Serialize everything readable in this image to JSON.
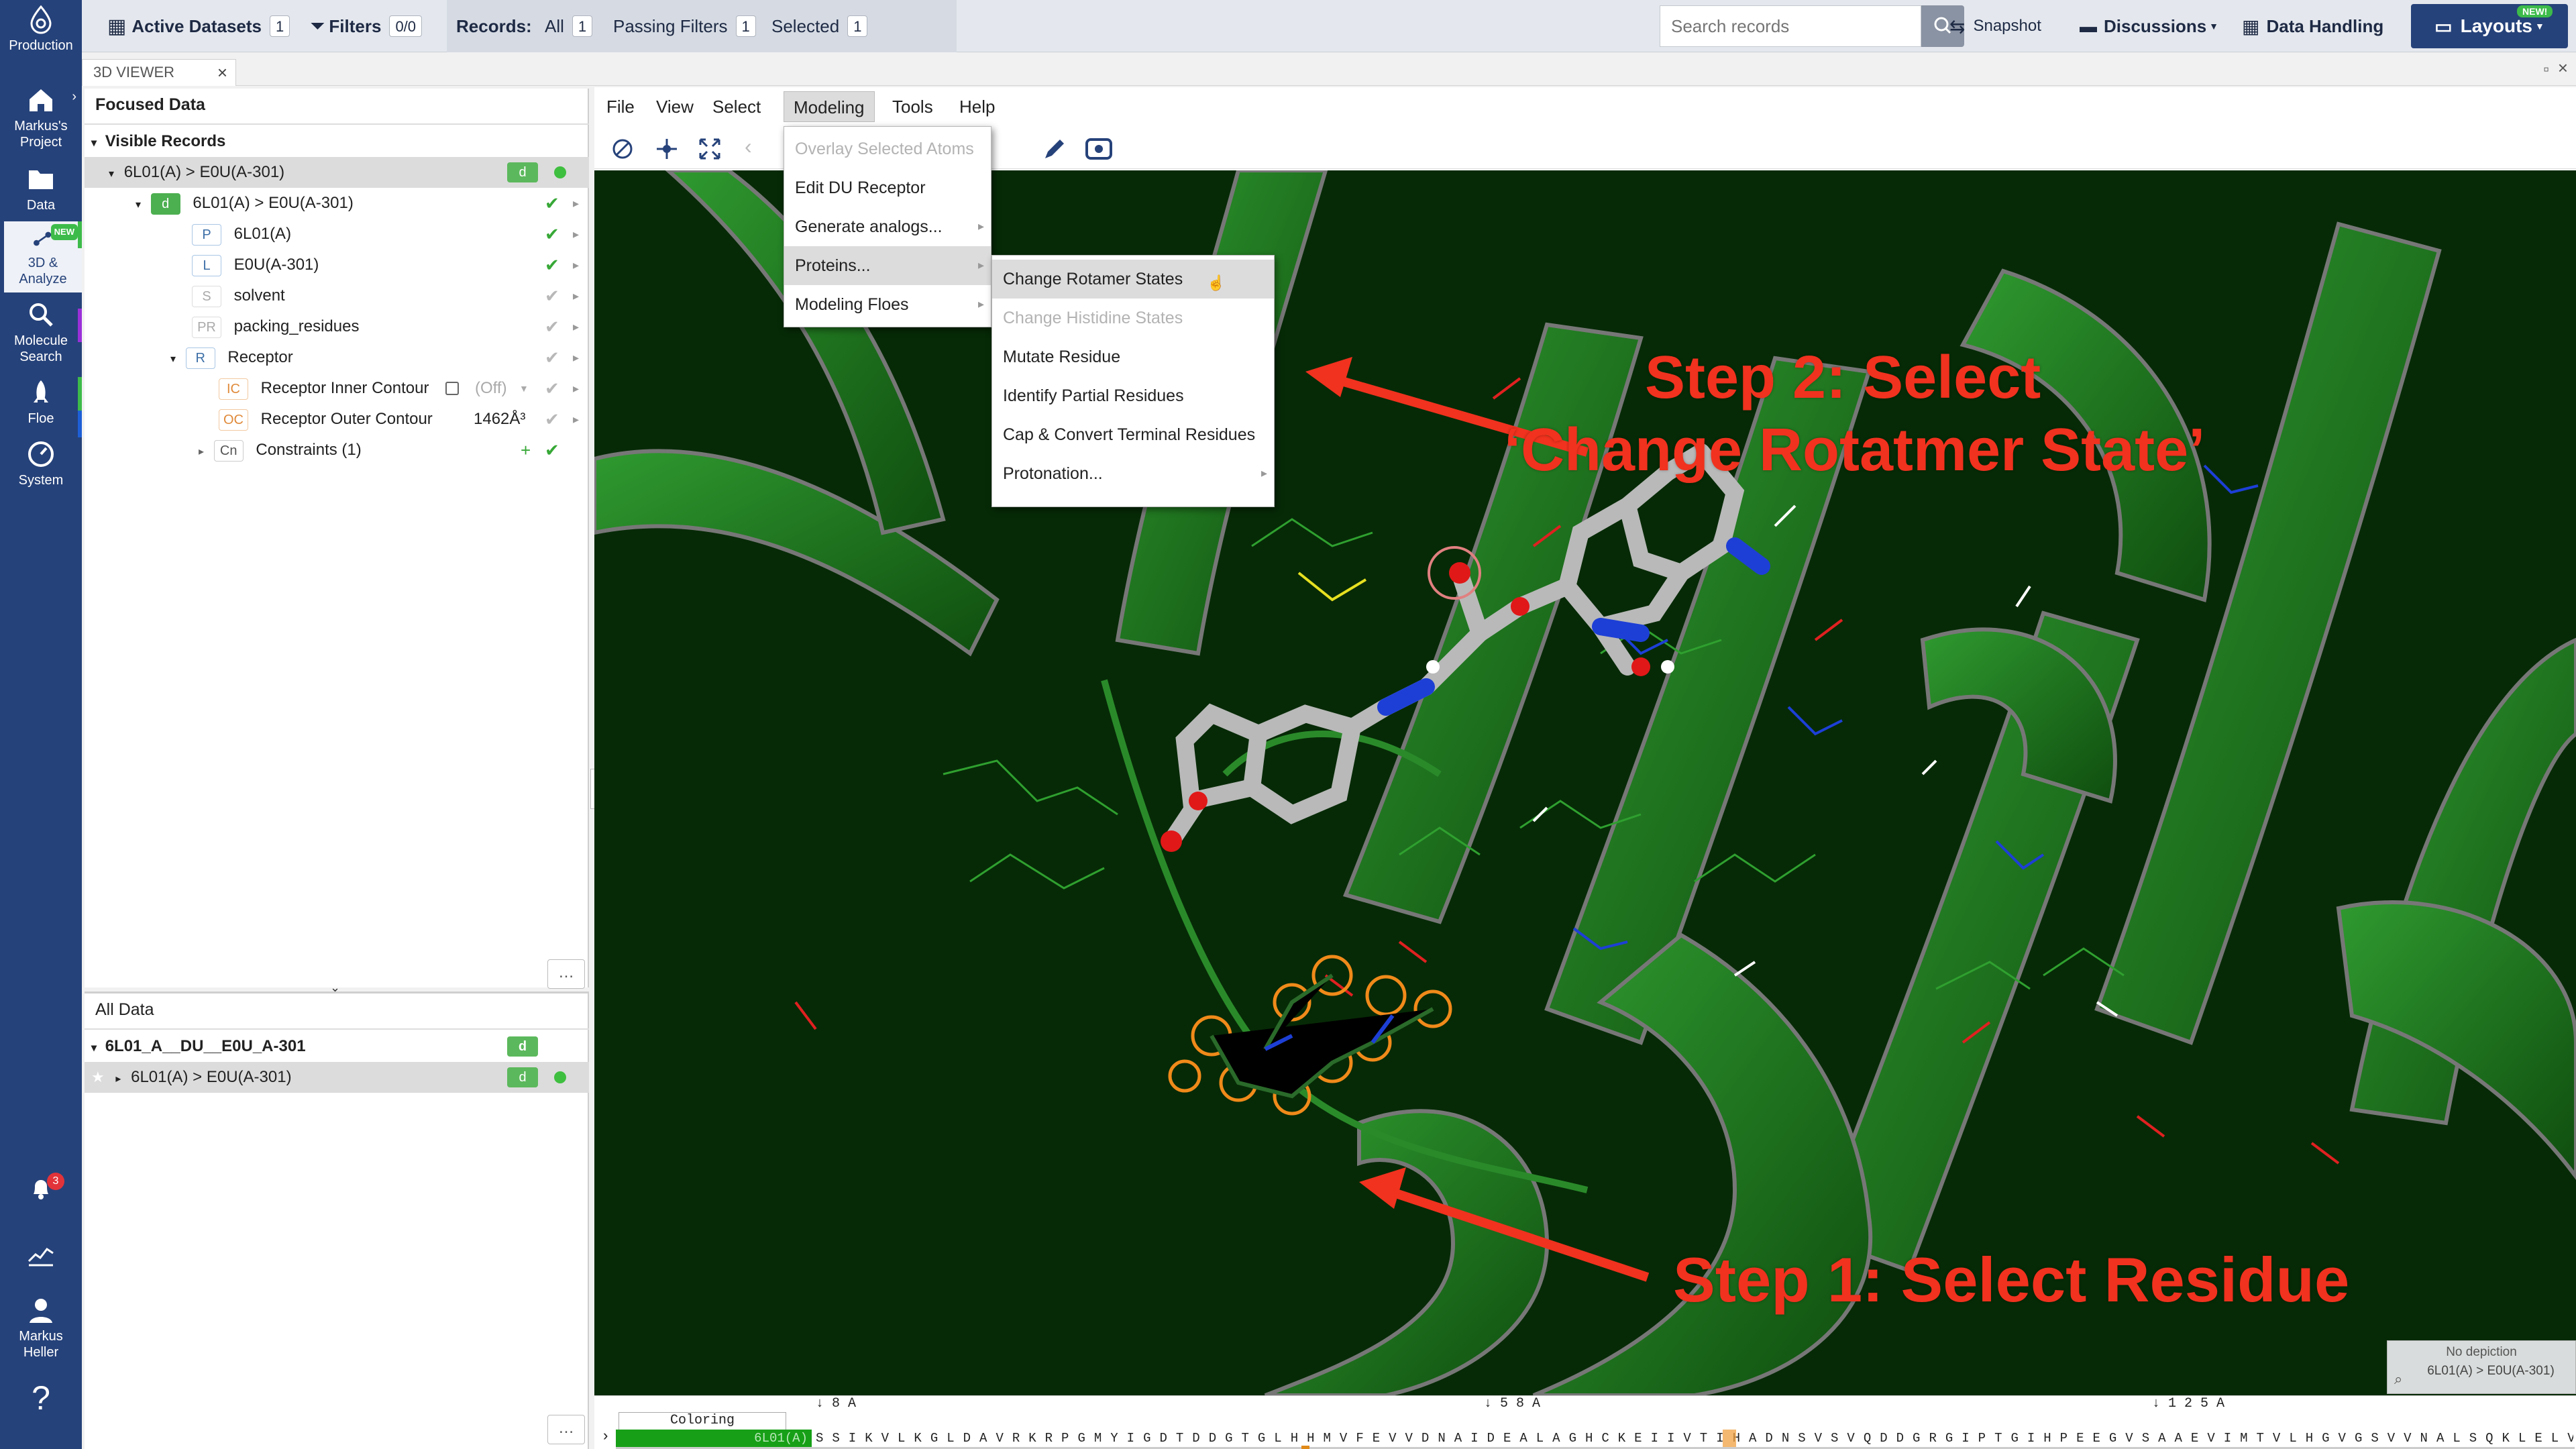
{
  "nav": {
    "production": "Production",
    "project": "Markus's\nProject",
    "data": "Data",
    "analyze_new": "NEW",
    "analyze": "3D &\nAnalyze",
    "molecule_search": "Molecule\nSearch",
    "floe": "Floe",
    "system": "System",
    "notif_count": "3",
    "user": "Markus\nHeller",
    "help": "?"
  },
  "topbar": {
    "active_datasets": "Active Datasets",
    "active_datasets_count": "1",
    "filters": "Filters",
    "filters_count": "0/0",
    "records": "Records:",
    "all": "All",
    "all_count": "1",
    "passing": "Passing Filters",
    "passing_count": "1",
    "selected": "Selected",
    "selected_count": "1",
    "search_placeholder": "Search records",
    "snapshot": "Snapshot",
    "discussions": "Discussions",
    "data_handling": "Data Handling",
    "layouts": "Layouts",
    "layouts_badge": "NEW!"
  },
  "viewer_tab": "3D VIEWER",
  "focused": {
    "title": "Focused Data",
    "visible_records": "Visible Records",
    "rows": [
      {
        "text": "6L01(A) > E0U(A-301)"
      },
      {
        "tag": "d",
        "text": "6L01(A) > E0U(A-301)"
      },
      {
        "tag": "P",
        "text": "6L01(A)"
      },
      {
        "tag": "L",
        "text": "E0U(A-301)"
      },
      {
        "tag": "S",
        "text": "solvent"
      },
      {
        "tag": "PR",
        "text": "packing_residues"
      },
      {
        "tag": "R",
        "text": "Receptor"
      },
      {
        "tag": "IC",
        "text": "Receptor Inner Contour",
        "extra": "(Off)"
      },
      {
        "tag": "OC",
        "text": "Receptor Outer Contour",
        "extra": "1462Å³"
      },
      {
        "tag": "Cn",
        "text": "Constraints (1)"
      }
    ],
    "pill": "d"
  },
  "alldata": {
    "title": "All Data",
    "group": "6L01_A__DU__E0U_A-301",
    "item": "6L01(A) > E0U(A-301)",
    "pill": "d"
  },
  "menubar": [
    "File",
    "View",
    "Select",
    "Modeling",
    "Tools",
    "Help"
  ],
  "modeling_menu": [
    {
      "label": "Overlay Selected Atoms",
      "disabled": true
    },
    {
      "label": "Edit DU Receptor"
    },
    {
      "label": "Generate analogs..."
    },
    {
      "label": "Proteins..."
    },
    {
      "label": "Modeling Floes"
    }
  ],
  "proteins_menu": [
    {
      "label": "Change Rotamer States"
    },
    {
      "label": "Change Histidine States",
      "disabled": true
    },
    {
      "label": "Mutate Residue"
    },
    {
      "label": "Identify Partial Residues"
    },
    {
      "label": "Cap & Convert Terminal Residues"
    },
    {
      "label": "Protonation..."
    }
  ],
  "annotations": {
    "step2_line1": "Step 2: Select",
    "step2_line2": "‘Change Rotatmer State’",
    "step1": "Step 1: Select Residue"
  },
  "sequence": {
    "coloring": "Coloring",
    "marker1": "↓ 8 A",
    "marker2": "↓ 5 8 A",
    "marker3": "↓ 1 2 5 A",
    "chain": "6L01(A)",
    "residues": "S S I K V L K G L D A V R K R P G M Y I G D T D D G T G L H H M V F E V V D N A I D E A L A G H C K E I I V T I H A D N S V S V Q D D G R G I P T G I H P E E G V S A A E V I M T V L H G V G S V V N A L S Q K L E L V I Q R E G K I H R Q I Y E H G V P Q A P L A V"
  },
  "no_depiction": {
    "title": "No depiction",
    "record": "6L01(A) > E0U(A-301)"
  },
  "colors": {
    "nav": "#26427a",
    "accent_red": "#f0321e",
    "scene_bg": "#062a06",
    "ribbon": "#1f7a1f"
  }
}
